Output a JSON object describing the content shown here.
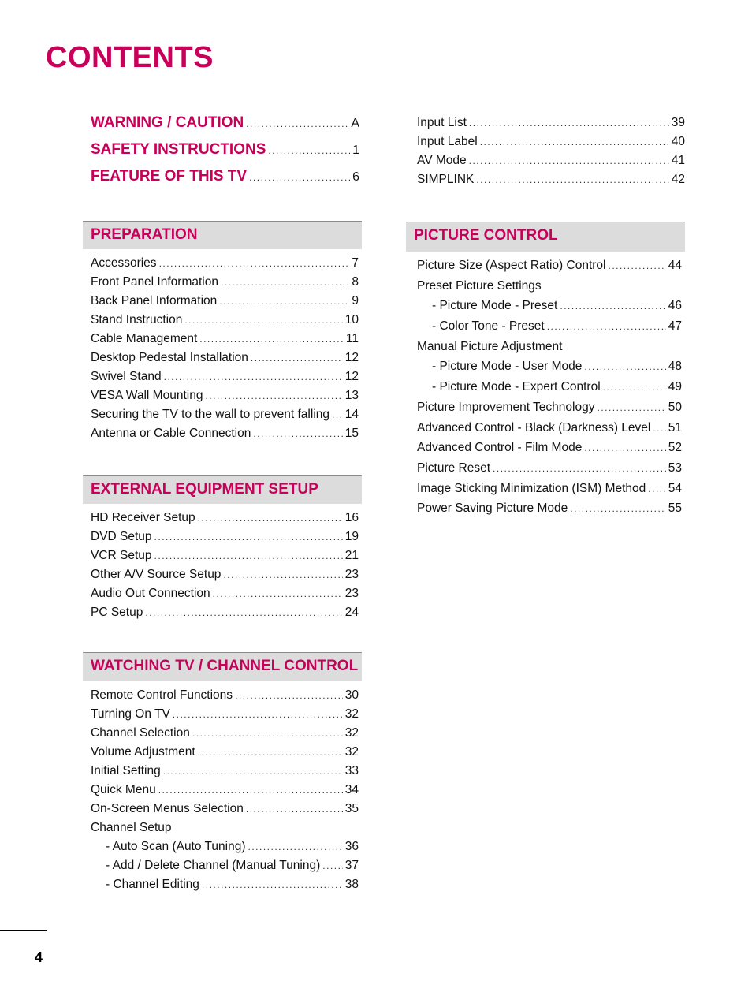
{
  "title": "CONTENTS",
  "top_links": [
    {
      "label": "WARNING / CAUTION",
      "page": "A"
    },
    {
      "label": "SAFETY INSTRUCTIONS",
      "page": "1"
    },
    {
      "label": "FEATURE OF THIS TV",
      "page": "6"
    }
  ],
  "sections": {
    "preparation": {
      "heading": "PREPARATION",
      "entries": [
        {
          "label": "Accessories",
          "page": "7"
        },
        {
          "label": "Front Panel Information",
          "page": "8"
        },
        {
          "label": "Back Panel Information",
          "page": "9"
        },
        {
          "label": "Stand Instruction",
          "page": "10"
        },
        {
          "label": "Cable Management",
          "page": "11"
        },
        {
          "label": "Desktop Pedestal Installation",
          "page": "12"
        },
        {
          "label": "Swivel Stand",
          "page": "12"
        },
        {
          "label": "VESA Wall Mounting",
          "page": "13"
        },
        {
          "label": "Securing the TV to the wall to prevent falling",
          "page": "14"
        },
        {
          "label": "Antenna or Cable Connection",
          "page": "15"
        }
      ]
    },
    "external": {
      "heading": "EXTERNAL EQUIPMENT SETUP",
      "entries": [
        {
          "label": "HD Receiver Setup",
          "page": "16"
        },
        {
          "label": "DVD Setup",
          "page": "19"
        },
        {
          "label": "VCR Setup",
          "page": "21"
        },
        {
          "label": "Other A/V Source Setup",
          "page": "23"
        },
        {
          "label": "Audio Out Connection",
          "page": "23"
        },
        {
          "label": "PC Setup",
          "page": "24"
        }
      ]
    },
    "watching": {
      "heading": "WATCHING TV / CHANNEL CONTROL",
      "entries": [
        {
          "label": "Remote Control Functions",
          "page": "30"
        },
        {
          "label": "Turning On TV",
          "page": "32"
        },
        {
          "label": "Channel Selection",
          "page": "32"
        },
        {
          "label": "Volume Adjustment",
          "page": "32"
        },
        {
          "label": "Initial Setting",
          "page": "33"
        },
        {
          "label": "Quick Menu",
          "page": "34"
        },
        {
          "label": "On-Screen Menus Selection",
          "page": "35"
        },
        {
          "label": "Channel Setup",
          "page": ""
        },
        {
          "label": "- Auto Scan (Auto Tuning)",
          "page": "36"
        },
        {
          "label": "- Add / Delete Channel (Manual Tuning)",
          "page": "37"
        },
        {
          "label": "- Channel Editing",
          "page": "38"
        }
      ]
    },
    "continued": {
      "entries": [
        {
          "label": "Input List",
          "page": "39"
        },
        {
          "label": "Input Label",
          "page": "40"
        },
        {
          "label": "AV Mode",
          "page": "41"
        },
        {
          "label": "SIMPLINK",
          "page": "42"
        }
      ]
    },
    "picture": {
      "heading": "PICTURE CONTROL",
      "entries": [
        {
          "label": "Picture Size (Aspect Ratio) Control",
          "page": "44"
        },
        {
          "label": "Preset Picture Settings",
          "page": ""
        },
        {
          "label": "- Picture Mode - Preset",
          "page": "46"
        },
        {
          "label": "- Color Tone - Preset",
          "page": "47"
        },
        {
          "label": "Manual Picture Adjustment",
          "page": ""
        },
        {
          "label": "- Picture Mode - User Mode",
          "page": "48"
        },
        {
          "label": "- Picture Mode - Expert Control",
          "page": "49"
        },
        {
          "label": "Picture Improvement Technology",
          "page": "50"
        },
        {
          "label": "Advanced Control - Black (Darkness) Level",
          "page": "51"
        },
        {
          "label": "Advanced Control - Film Mode",
          "page": "52"
        },
        {
          "label": "Picture Reset",
          "page": "53"
        },
        {
          "label": "Image Sticking Minimization (ISM) Method",
          "page": "54"
        },
        {
          "label": "Power Saving Picture Mode",
          "page": "55"
        }
      ]
    }
  },
  "footer": {
    "page_number": "4"
  }
}
